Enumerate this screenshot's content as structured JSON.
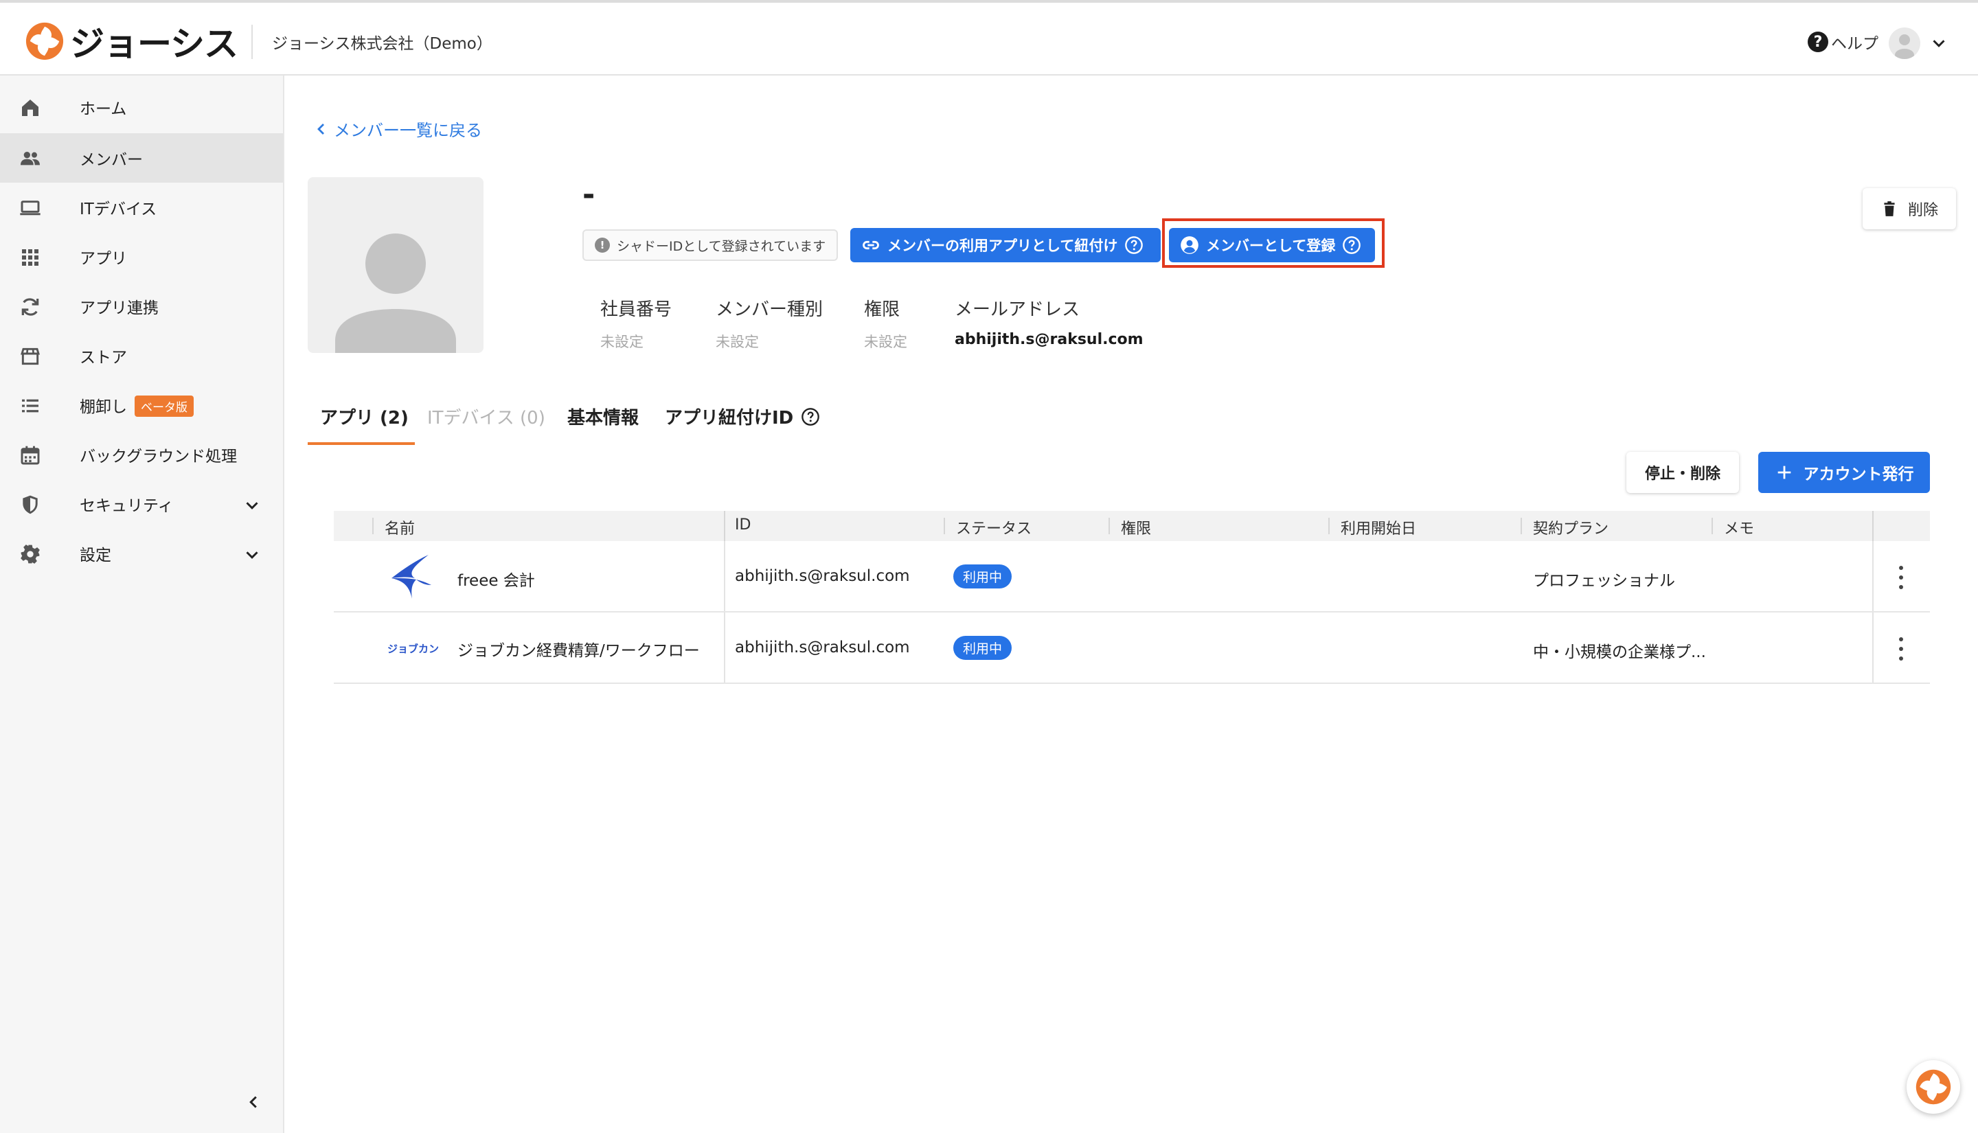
{
  "header": {
    "logo_text": "ジョーシス",
    "company_name": "ジョーシス株式会社（Demo）",
    "help_label": "ヘルプ"
  },
  "sidebar": {
    "items": [
      {
        "label": "ホーム",
        "icon": "home-icon"
      },
      {
        "label": "メンバー",
        "icon": "people-icon",
        "active": true
      },
      {
        "label": "ITデバイス",
        "icon": "laptop-icon"
      },
      {
        "label": "アプリ",
        "icon": "grid-icon"
      },
      {
        "label": "アプリ連携",
        "icon": "sync-icon"
      },
      {
        "label": "ストア",
        "icon": "store-icon"
      },
      {
        "label": "棚卸し",
        "icon": "list-icon",
        "badge": "ベータ版"
      },
      {
        "label": "バックグラウンド処理",
        "icon": "calendar-icon"
      },
      {
        "label": "セキュリティ",
        "icon": "shield-icon"
      },
      {
        "label": "設定",
        "icon": "gear-icon"
      }
    ]
  },
  "main": {
    "back_link": "メンバー一覧に戻る",
    "member_name": "-",
    "shadow_badge": "シャドーIDとして登録されています",
    "link_apps_button": "メンバーの利用アプリとして紐付け",
    "register_button": "メンバーとして登録",
    "delete_button": "削除",
    "info": {
      "employee_no_label": "社員番号",
      "employee_no_value": "未設定",
      "member_type_label": "メンバー種別",
      "member_type_value": "未設定",
      "role_label": "権限",
      "role_value": "未設定",
      "email_label": "メールアドレス",
      "email_value": "abhijith.s@raksul.com"
    },
    "tabs": [
      {
        "label": "アプリ (2)",
        "active": true
      },
      {
        "label": "ITデバイス (0)",
        "disabled": true
      },
      {
        "label": "基本情報"
      },
      {
        "label": "アプリ紐付けID"
      }
    ],
    "stop_delete_button": "停止・削除",
    "issue_account_button": "アカウント発行",
    "table": {
      "columns": [
        "名前",
        "ID",
        "ステータス",
        "権限",
        "利用開始日",
        "契約プラン",
        "メモ"
      ],
      "rows": [
        {
          "logo": "freee-logo",
          "name": "freee 会計",
          "id": "abhijith.s@raksul.com",
          "status": "利用中",
          "role": "",
          "start_date": "",
          "plan": "プロフェッショナル",
          "memo": ""
        },
        {
          "logo": "jobcan-logo",
          "logo_text": "ジョブカン",
          "name": "ジョブカン経費精算/ワークフロー",
          "id": "abhijith.s@raksul.com",
          "status": "利用中",
          "role": "",
          "start_date": "",
          "plan": "中・小規模の企業様プ...",
          "memo": ""
        }
      ]
    }
  },
  "colors": {
    "primary": "#2673e6",
    "accent_orange": "#ee7a30",
    "highlight_red": "#e03a1e",
    "link_blue": "#2f7be0"
  }
}
